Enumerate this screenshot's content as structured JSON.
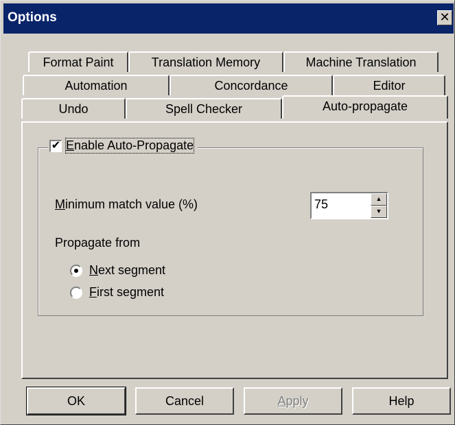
{
  "window": {
    "title": "Options",
    "close_glyph": "✕"
  },
  "tabs": {
    "row1": [
      "Format Paint",
      "Translation Memory",
      "Machine Translation"
    ],
    "row2": [
      "Automation",
      "Concordance",
      "Editor"
    ],
    "row3": [
      "Undo",
      "Spell Checker",
      "Auto-propagate"
    ],
    "active": "Auto-propagate"
  },
  "autopropagate": {
    "enable_label_accel": "E",
    "enable_label_rest": "nable Auto-Propagate",
    "enable_checked": true,
    "check_glyph": "✔",
    "min_match_accel": "M",
    "min_match_rest": "inimum match value (%)",
    "min_match_value": "75",
    "spin_up_glyph": "▲",
    "spin_down_glyph": "▼",
    "propagate_from_label": "Propagate from",
    "options": [
      {
        "accel": "N",
        "rest": "ext segment",
        "checked": true
      },
      {
        "accel": "F",
        "rest": "irst segment",
        "checked": false
      }
    ]
  },
  "buttons": {
    "ok": "OK",
    "cancel": "Cancel",
    "apply_accel": "A",
    "apply_rest": "pply",
    "help": "Help"
  }
}
